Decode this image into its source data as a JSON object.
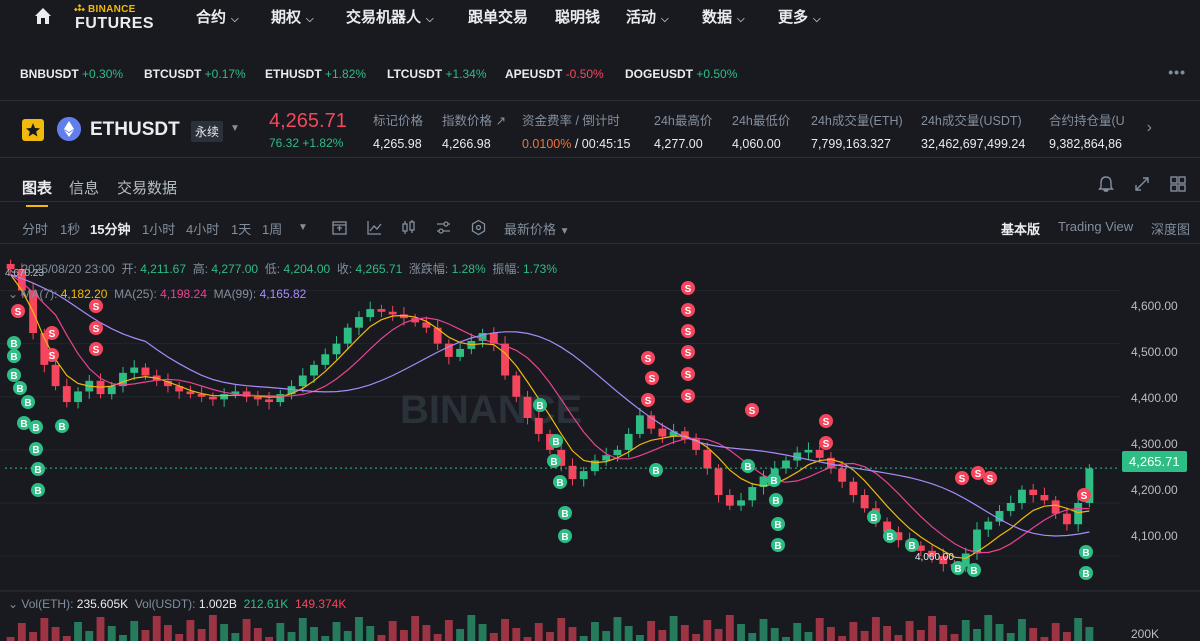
{
  "nav": {
    "logo_top": "BINANCE",
    "logo_bottom": "FUTURES",
    "items": [
      {
        "label": "合约",
        "has_menu": true
      },
      {
        "label": "期权",
        "has_menu": true
      },
      {
        "label": "交易机器人",
        "has_menu": true
      },
      {
        "label": "跟单交易",
        "has_menu": false
      },
      {
        "label": "聪明钱",
        "has_menu": false
      },
      {
        "label": "活动",
        "has_menu": true
      },
      {
        "label": "数据",
        "has_menu": true
      },
      {
        "label": "更多",
        "has_menu": true
      }
    ]
  },
  "tickers": [
    {
      "symbol": "BNBUSDT",
      "change": "+0.30%",
      "dir": "up"
    },
    {
      "symbol": "BTCUSDT",
      "change": "+0.17%",
      "dir": "up"
    },
    {
      "symbol": "ETHUSDT",
      "change": "+1.82%",
      "dir": "up"
    },
    {
      "symbol": "LTCUSDT",
      "change": "+1.34%",
      "dir": "up"
    },
    {
      "symbol": "APEUSDT",
      "change": "-0.50%",
      "dir": "down"
    },
    {
      "symbol": "DOGEUSDT",
      "change": "+0.50%",
      "dir": "up"
    }
  ],
  "header": {
    "symbol": "ETHUSDT",
    "contract_type": "永续",
    "last_price": "4,265.71",
    "change_abs": "76.32",
    "change_pct": "+1.82%",
    "stats": [
      {
        "label": "标记价格",
        "value": "4,265.98"
      },
      {
        "label": "指数价格 ↗",
        "value": "4,266.98"
      },
      {
        "label": "资金费率 / 倒计时",
        "value_rate": "0.0100%",
        "value_countdown": "/ 00:45:15"
      },
      {
        "label": "24h最高价",
        "value": "4,277.00"
      },
      {
        "label": "24h最低价",
        "value": "4,060.00"
      },
      {
        "label": "24h成交量(ETH)",
        "value": "7,799,163.327"
      },
      {
        "label": "24h成交量(USDT)",
        "value": "32,462,697,499.24"
      },
      {
        "label": "合约持仓量(U",
        "value": "9,382,864,86"
      }
    ]
  },
  "tabs": [
    "图表",
    "信息",
    "交易数据"
  ],
  "toolbar": {
    "timeframes": [
      "分时",
      "1秒",
      "15分钟",
      "1小时",
      "4小时",
      "1天",
      "1周"
    ],
    "selected": "15分钟",
    "price_type": "最新价格",
    "views": [
      "基本版",
      "Trading View",
      "深度图"
    ],
    "selected_view": "基本版"
  },
  "legend": {
    "date": "2025/08/20 23:00",
    "open_label": "开:",
    "open": "4,211.67",
    "high_label": "高:",
    "high": "4,277.00",
    "low_label": "低:",
    "low": "4,204.00",
    "close_label": "收:",
    "close": "4,265.71",
    "chg_label": "涨跌幅:",
    "chg": "1.28%",
    "amp_label": "振幅:",
    "amp": "1.73%",
    "ma7_label": "MA(7):",
    "ma7": "4,182.20",
    "ma25_label": "MA(25):",
    "ma25": "4,198.24",
    "ma99_label": "MA(99):",
    "ma99": "4,165.82",
    "vol_label": "Vol(ETH):",
    "vol_eth": "235.605K",
    "volu_label": "Vol(USDT):",
    "vol_usdt": "1.002B",
    "vol_a": "212.61K",
    "vol_b": "149.374K"
  },
  "chart_labels": {
    "max_mark": "4,670.23",
    "min_mark": "4,060.00",
    "current_price": "4,265.71",
    "y_ticks": [
      "4,600.00",
      "4,500.00",
      "4,400.00",
      "4,300.00",
      "4,200.00",
      "4,100.00"
    ],
    "vol_tick": "200K",
    "watermark": "BINANCE",
    "buy": "B",
    "sell": "S"
  },
  "colors": {
    "up": "#2ebd85",
    "down": "#f6465d",
    "accent": "#f0b90b",
    "ma7": "#f0b90b",
    "ma25": "#e84393",
    "ma99": "#a78bfa"
  },
  "chart_data": {
    "type": "candlestick",
    "interval": "15分钟",
    "y_range": [
      4040,
      4680
    ],
    "closes": [
      4640,
      4600,
      4520,
      4460,
      4420,
      4390,
      4410,
      4430,
      4405,
      4420,
      4445,
      4455,
      4440,
      4430,
      4420,
      4410,
      4405,
      4400,
      4395,
      4405,
      4410,
      4400,
      4395,
      4390,
      4405,
      4420,
      4440,
      4460,
      4480,
      4500,
      4530,
      4550,
      4565,
      4560,
      4555,
      4548,
      4540,
      4530,
      4500,
      4475,
      4490,
      4505,
      4520,
      4500,
      4440,
      4400,
      4360,
      4330,
      4300,
      4270,
      4245,
      4260,
      4280,
      4290,
      4300,
      4330,
      4365,
      4340,
      4325,
      4335,
      4320,
      4300,
      4265,
      4215,
      4195,
      4205,
      4230,
      4250,
      4265,
      4280,
      4295,
      4300,
      4285,
      4265,
      4240,
      4215,
      4190,
      4165,
      4145,
      4130,
      4120,
      4110,
      4100,
      4085,
      4080,
      4105,
      4150,
      4165,
      4185,
      4200,
      4225,
      4215,
      4205,
      4180,
      4160,
      4200,
      4265
    ],
    "ma7": [
      4630,
      4600,
      4560,
      4510,
      4470,
      4440,
      4425,
      4420,
      4418,
      4420,
      4428,
      4435,
      4438,
      4435,
      4428,
      4420,
      4412,
      4406,
      4402,
      4402,
      4403,
      4403,
      4401,
      4399,
      4400,
      4406,
      4416,
      4430,
      4448,
      4468,
      4490,
      4512,
      4532,
      4545,
      4552,
      4553,
      4550,
      4542,
      4528,
      4512,
      4502,
      4498,
      4500,
      4498,
      4482,
      4458,
      4428,
      4396,
      4364,
      4330,
      4298,
      4280,
      4276,
      4278,
      4285,
      4296,
      4310,
      4318,
      4322,
      4326,
      4326,
      4318,
      4305,
      4285,
      4262,
      4246,
      4236,
      4232,
      4236,
      4246,
      4258,
      4272,
      4280,
      4282,
      4276,
      4262,
      4242,
      4218,
      4194,
      4172,
      4152,
      4136,
      4122,
      4110,
      4098,
      4096,
      4108,
      4122,
      4138,
      4152,
      4170,
      4186,
      4194,
      4196,
      4190,
      4182,
      4185
    ]
  }
}
